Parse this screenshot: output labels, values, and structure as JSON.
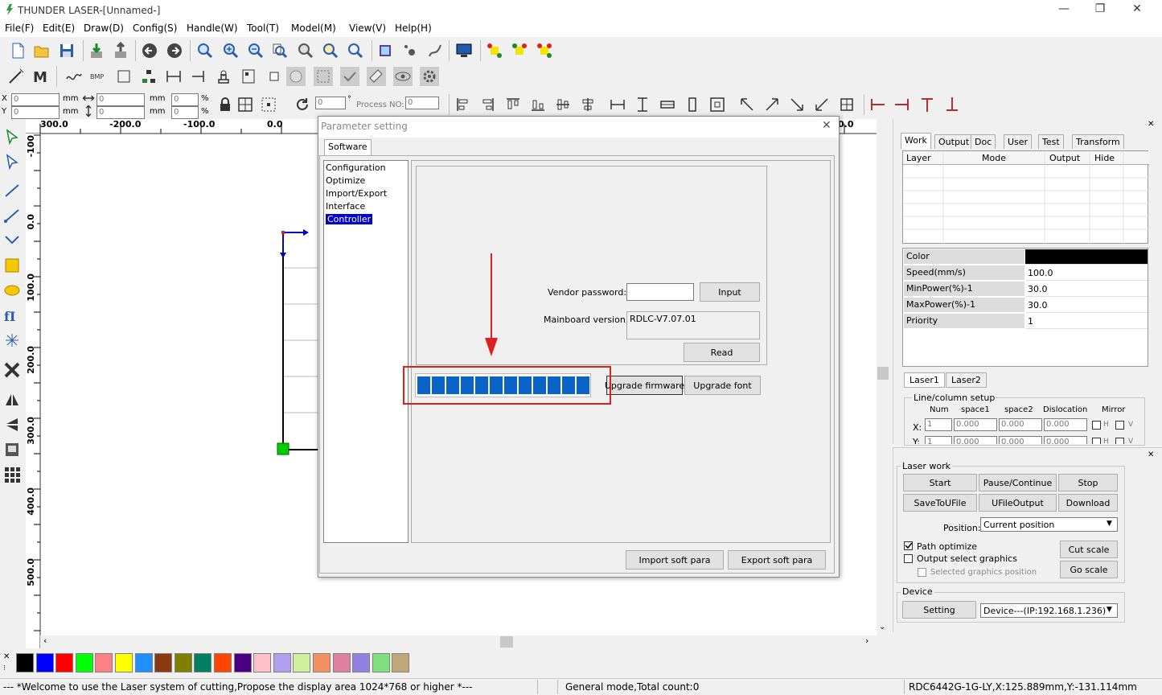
{
  "window": {
    "title": "THUNDER LASER-[Unnamed-]",
    "min": "—",
    "restore": "❐",
    "close": "✕"
  },
  "menu": [
    "File(F)",
    "Edit(E)",
    "Draw(D)",
    "Config(S)",
    "Handle(W)",
    "Tool(T)",
    "Model(M)",
    "View(V)",
    "Help(H)"
  ],
  "coords": {
    "x_label": "X",
    "y_label": "Y",
    "x_value": "0",
    "y_value": "0",
    "unit": "mm",
    "w_value": "0",
    "h_value": "0",
    "pw_value": "0",
    "ph_value": "0",
    "pct": "%",
    "angle_value": "0",
    "deg": "°",
    "process_label": "Process NO:",
    "process_value": "0"
  },
  "ruler_top": [
    "300.0",
    "-200.0",
    "-100.0",
    "0.0",
    "0.0"
  ],
  "ruler_left": [
    "-100",
    "0.0",
    "100.0",
    "200.0",
    "300.0",
    "400.0",
    "500.0"
  ],
  "dialog": {
    "title": "Parameter setting",
    "tab": "Software",
    "tree": [
      "Configuration",
      "Optimize",
      "Import/Export",
      "Interface",
      "Controller"
    ],
    "selected_tree_index": 4,
    "vendor_password_label": "Vendor password:",
    "vendor_password_value": "",
    "input_button": "Input",
    "mainboard_label": "Mainboard version:",
    "mainboard_value": "RDLC-V7.07.01",
    "read_button": "Read",
    "upgrade_firmware_button": "Upgrade firmware",
    "upgrade_font_button": "Upgrade font",
    "progress_segments": 12,
    "import_button": "Import soft para",
    "export_button": "Export soft para"
  },
  "right_panel": {
    "tabs": [
      "Work",
      "Output",
      "Doc",
      "User",
      "Test",
      "Transform"
    ],
    "layer_columns": [
      "Layer",
      "Mode",
      "Output",
      "Hide"
    ],
    "props": [
      {
        "label": "Color",
        "value": ""
      },
      {
        "label": "Speed(mm/s)",
        "value": "100.0"
      },
      {
        "label": "MinPower(%)-1",
        "value": "30.0"
      },
      {
        "label": "MaxPower(%)-1",
        "value": "30.0"
      },
      {
        "label": "Priority",
        "value": "1"
      }
    ],
    "laser_tabs": [
      "Laser1",
      "Laser2"
    ],
    "line_col_title": "Line/column setup",
    "lc_headers": [
      "Num",
      "space1",
      "space2",
      "Dislocation",
      "Mirror"
    ],
    "lc_x_label": "X:",
    "lc_x": [
      "1",
      "0.000",
      "0.000",
      "0.000"
    ],
    "lc_y_label": "Y:",
    "lc_y": [
      "1",
      "0.000",
      "0.000",
      "0.000"
    ],
    "mirror_h": "H",
    "mirror_v": "V"
  },
  "laser_work": {
    "title": "Laser work",
    "buttons": [
      "Start",
      "Pause/Continue",
      "Stop",
      "SaveToUFile",
      "UFileOutput",
      "Download"
    ],
    "position_label": "Position:",
    "position_value": "Current position",
    "path_optimize": "Path optimize",
    "output_select": "Output select graphics",
    "selected_pos": "Selected graphics position",
    "cut_scale": "Cut scale",
    "go_scale": "Go scale"
  },
  "device": {
    "title": "Device",
    "setting": "Setting",
    "value": "Device---(IP:192.168.1.236)"
  },
  "palette": [
    "#000000",
    "#0000ff",
    "#ff0000",
    "#00ff00",
    "#ff8080",
    "#ffff00",
    "#1e90ff",
    "#8b3a0f",
    "#808000",
    "#008060",
    "#ff4500",
    "#4b0082",
    "#ffc0cb",
    "#b0a0f0",
    "#d0f0a0",
    "#f49060",
    "#e080a0",
    "#9080e0",
    "#80e080",
    "#c0a878"
  ],
  "status": {
    "welcome": "--- *Welcome to use the Laser system of cutting,Propose the display area 1024*768 or higher *---",
    "mode": "General mode,Total count:0",
    "device": "RDC6442G-1G-LY,X:125.889mm,Y:-131.114mm"
  },
  "colors": {
    "accent": "#0a64c8",
    "highlight": "#e02020",
    "selection": "#0000cc"
  }
}
